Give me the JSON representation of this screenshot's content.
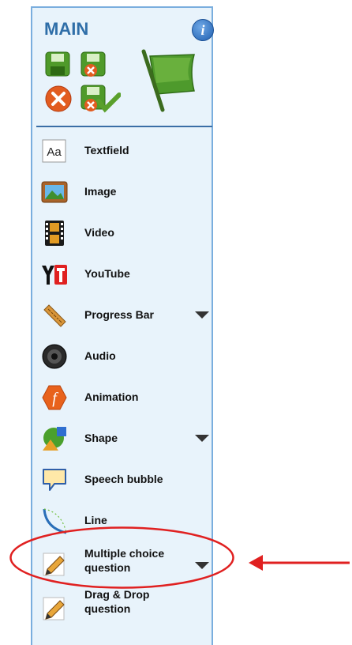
{
  "panel": {
    "title": "MAIN",
    "toolbar": {
      "save": "save-icon",
      "save_close": "save-close-icon",
      "close": "close-icon",
      "save_check": "save-check-icon",
      "flag": "flag-icon"
    },
    "items": [
      {
        "label": "Textfield"
      },
      {
        "label": "Image"
      },
      {
        "label": "Video"
      },
      {
        "label": "YouTube"
      },
      {
        "label": "Progress Bar"
      },
      {
        "label": "Audio"
      },
      {
        "label": "Animation"
      },
      {
        "label": "Shape"
      },
      {
        "label": "Speech bubble"
      },
      {
        "label": "Line"
      },
      {
        "label_line1": "Multiple choice",
        "label_line2": "question"
      },
      {
        "label_line1": "Drag & Drop",
        "label_line2": "question"
      }
    ]
  },
  "annotation": {
    "highlight_color": "#e02020"
  }
}
